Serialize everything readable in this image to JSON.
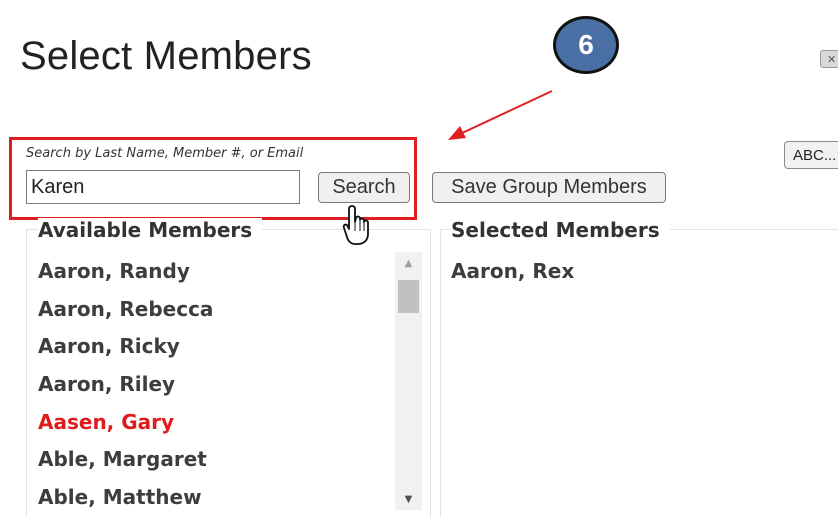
{
  "dialog": {
    "title": "Select Members",
    "step_number": "6",
    "close_label": "✕",
    "abc_label": "ABC..."
  },
  "search": {
    "hint": "Search by Last Name, Member #, or Email",
    "value": "Karen",
    "button_label": "Search"
  },
  "toolbar": {
    "save_label": "Save Group Members"
  },
  "available": {
    "heading": "Available Members",
    "members": [
      {
        "name": "Aaron, Randy",
        "flagged": false
      },
      {
        "name": "Aaron, Rebecca",
        "flagged": false
      },
      {
        "name": "Aaron, Ricky",
        "flagged": false
      },
      {
        "name": "Aaron, Riley",
        "flagged": false
      },
      {
        "name": "Aasen, Gary",
        "flagged": true
      },
      {
        "name": "Able, Margaret",
        "flagged": false
      },
      {
        "name": "Able, Matthew",
        "flagged": false
      }
    ]
  },
  "selected": {
    "heading": "Selected Members",
    "members": [
      "Aaron, Rex"
    ]
  },
  "colors": {
    "highlight": "#e02020",
    "flagged_member": "#e01b1b",
    "badge": "#4a6fa5"
  },
  "icons": {
    "step_badge": "numbered-circle-icon",
    "arrow": "red-arrow-icon",
    "cursor": "hand-pointer-icon",
    "scroll_up": "scroll-up-arrow-icon",
    "scroll_down": "scroll-down-arrow-icon"
  }
}
